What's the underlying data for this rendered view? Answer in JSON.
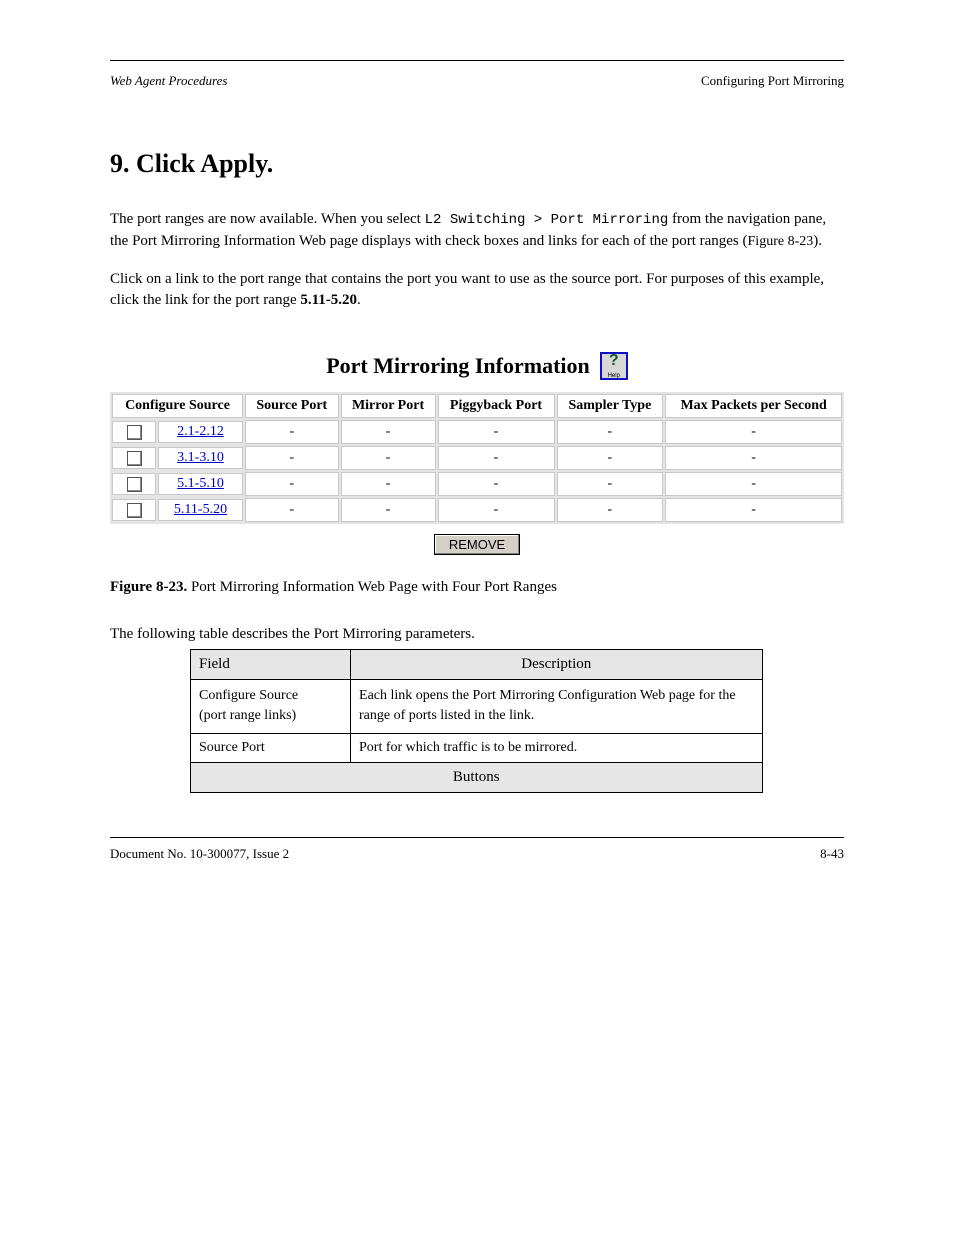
{
  "header": {
    "left": "Web Agent Procedures",
    "right": "Configuring Port Mirroring"
  },
  "section": {
    "number": "9.",
    "title": "Click Apply."
  },
  "para1_a": "The port ranges are now available. When you select ",
  "para1_mono": "L2 Switching > Port Mirroring",
  "para1_b": " from the navigation pane, the Port Mirroring Information Web page displays with check boxes and links for each of the port ranges (",
  "para1_link": "Figure 8-23",
  "para1_c": ").",
  "para2_a": "Click on a link to the port range that contains the port you want to use as the source port. For purposes of this example, click the link for the port range ",
  "para2_b_bold": "5.11-5.20",
  "para2_c": ".",
  "figure": {
    "title": "Port Mirroring Information",
    "headers": [
      "Configure Source",
      "Source Port",
      "Mirror Port",
      "Piggyback Port",
      "Sampler Type",
      "Max Packets per Second"
    ],
    "rows": [
      {
        "link": "2.1-2.12",
        "src": "-",
        "mirror": "-",
        "piggy": "-",
        "sampler": "-",
        "max": "-"
      },
      {
        "link": "3.1-3.10",
        "src": "-",
        "mirror": "-",
        "piggy": "-",
        "sampler": "-",
        "max": "-"
      },
      {
        "link": "5.1-5.10",
        "src": "-",
        "mirror": "-",
        "piggy": "-",
        "sampler": "-",
        "max": "-"
      },
      {
        "link": "5.11-5.20",
        "src": "-",
        "mirror": "-",
        "piggy": "-",
        "sampler": "-",
        "max": "-"
      }
    ],
    "remove": "REMOVE"
  },
  "caption": {
    "label": "Figure 8-23.",
    "text": "Port Mirroring Information Web Page with Four Port Ranges"
  },
  "desc_intro": "The following table describes the Port Mirroring parameters.",
  "desc": {
    "h_field": "Field",
    "h_desc": "Description",
    "r1_field_a": "Configure Source",
    "r1_field_b": "(port range links)",
    "r1_desc": "Each link opens the Port Mirroring Configuration Web page for the range of ports listed in the link.",
    "r2_field": "Source Port",
    "r2_desc": "Port for which traffic is to be mirrored.",
    "buttons": "Buttons"
  },
  "footer": {
    "left": "Document No. 10-300077, Issue 2",
    "right": "8-43"
  }
}
